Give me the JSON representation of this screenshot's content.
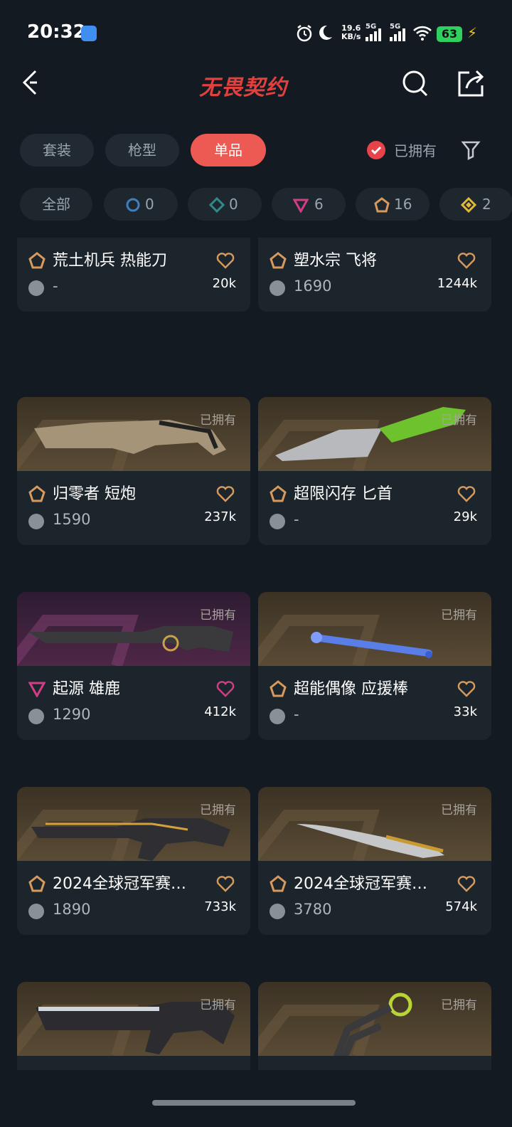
{
  "status": {
    "time": "20:32",
    "net_speed_value": "19.6",
    "net_speed_unit": "KB/s",
    "sig1": "5G",
    "sig2": "5G",
    "battery": "63"
  },
  "header": {
    "title": "无畏契约"
  },
  "tabs": [
    {
      "label": "套装"
    },
    {
      "label": "枪型"
    },
    {
      "label": "单品",
      "active": true
    }
  ],
  "owned_filter": {
    "label": "已拥有",
    "checked": true
  },
  "chips": [
    {
      "label": "全部"
    },
    {
      "count": "0",
      "icon": "circle-tier-icon",
      "color": "#3f7fbf"
    },
    {
      "count": "0",
      "icon": "diamond-tier-icon",
      "color": "#2f8a88"
    },
    {
      "count": "6",
      "icon": "triangle-tier-icon",
      "color": "#d23e86"
    },
    {
      "count": "16",
      "icon": "pentagon-tier-icon",
      "color": "#d79a5c"
    },
    {
      "count": "2",
      "icon": "gold-diamond-tier-icon",
      "color": "#e2b83a"
    }
  ],
  "items": [
    {
      "name": "荒土机兵 热能刀",
      "price": "-",
      "likes": "20k",
      "owned": "",
      "tier": "pentagon"
    },
    {
      "name": "塑水宗 飞将",
      "price": "1690",
      "likes": "1244k",
      "owned": "",
      "tier": "pentagon"
    },
    {
      "name": "归零者 短炮",
      "price": "1590",
      "likes": "237k",
      "owned": "已拥有",
      "tier": "pentagon"
    },
    {
      "name": "超限闪存 匕首",
      "price": "-",
      "likes": "29k",
      "owned": "已拥有",
      "tier": "pentagon"
    },
    {
      "name": "起源 雄鹿",
      "price": "1290",
      "likes": "412k",
      "owned": "已拥有",
      "tier": "triangle"
    },
    {
      "name": "超能偶像 应援棒",
      "price": "-",
      "likes": "33k",
      "owned": "已拥有",
      "tier": "pentagon"
    },
    {
      "name": "2024全球冠军赛…",
      "price": "1890",
      "likes": "733k",
      "owned": "已拥有",
      "tier": "pentagon"
    },
    {
      "name": "2024全球冠军赛…",
      "price": "3780",
      "likes": "574k",
      "owned": "已拥有",
      "tier": "pentagon"
    },
    {
      "name": "",
      "price": "",
      "likes": "",
      "owned": "已拥有",
      "tier": "pentagon"
    },
    {
      "name": "",
      "price": "",
      "likes": "",
      "owned": "已拥有",
      "tier": "pentagon"
    }
  ]
}
